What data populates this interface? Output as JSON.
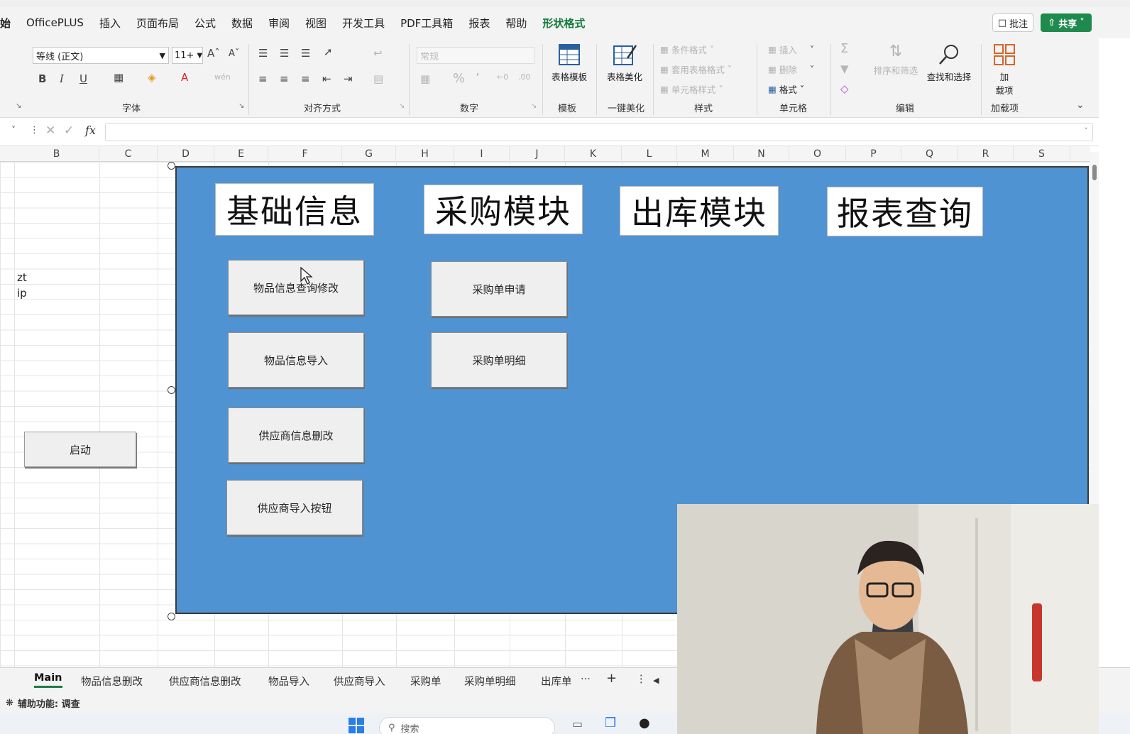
{
  "menu": {
    "items": [
      "始",
      "OfficePLUS",
      "插入",
      "页面布局",
      "公式",
      "数据",
      "审阅",
      "视图",
      "开发工具",
      "PDF工具箱",
      "报表",
      "帮助",
      "形状格式"
    ],
    "comment_label": "批注",
    "share_label": "共享"
  },
  "ribbon": {
    "font_name": "等线 (正文)",
    "font_size": "11+",
    "number_format": "常规",
    "groups": {
      "font": "字体",
      "align": "对齐方式",
      "number": "数字",
      "template": "模板",
      "beautify": "一键美化",
      "style": "样式",
      "cells": "单元格",
      "edit": "编辑",
      "addins": "加载项"
    },
    "buttons": {
      "table_template": "表格模板",
      "table_beautify": "表格美化",
      "conditional_format": "条件格式",
      "table_format": "套用表格格式",
      "cell_style": "单元格样式",
      "insert": "插入",
      "delete": "删除",
      "format": "格式",
      "sort_filter": "排序和筛选",
      "find_select": "查找和选择",
      "addin_top": "加",
      "addin_bottom": "载项"
    }
  },
  "formula_bar": {
    "fx": "fx",
    "value": ""
  },
  "columns": [
    "B",
    "C",
    "D",
    "E",
    "F",
    "G",
    "H",
    "I",
    "J",
    "K",
    "L",
    "M",
    "N",
    "O",
    "P",
    "Q",
    "R",
    "S"
  ],
  "cells": {
    "b_row_a": "zt",
    "b_row_b": "ip"
  },
  "start_button": "启动",
  "panel": {
    "headers": [
      "基础信息",
      "采购模块",
      "出库模块",
      "报表查询"
    ],
    "basic_buttons": [
      "物品信息查询修改",
      "物品信息导入",
      "供应商信息删改",
      "供应商导入按钮"
    ],
    "purchase_buttons": [
      "采购单申请",
      "采购单明细"
    ]
  },
  "sheet_tabs": [
    "Main",
    "物品信息删改",
    "供应商信息删改",
    "物品导入",
    "供应商导入",
    "采购单",
    "采购单明细",
    "出库单"
  ],
  "sheet_tab_more": "···",
  "sheet_tab_add": "+",
  "status": "辅助功能: 调查",
  "taskbar": {
    "search_placeholder": "搜索"
  }
}
